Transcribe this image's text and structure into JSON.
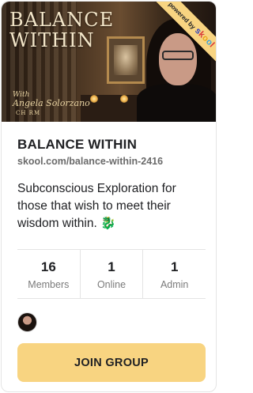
{
  "banner": {
    "title_line1": "BALANCE",
    "title_line2": "WITHIN",
    "with_text": "With",
    "host_name": "Angela Solorzano",
    "credentials": "CH RM",
    "ribbon_powered": "powered by",
    "ribbon_brand": [
      "s",
      "k",
      "o",
      "o",
      "l"
    ]
  },
  "group": {
    "name": "BALANCE WITHIN",
    "url": "skool.com/balance-within-2416",
    "description": "Subconscious Exploration for those that wish to meet their wisdom within.",
    "description_emoji": "🐉"
  },
  "stats": [
    {
      "value": "16",
      "label": "Members"
    },
    {
      "value": "1",
      "label": "Online"
    },
    {
      "value": "1",
      "label": "Admin"
    }
  ],
  "join_button": {
    "label": "JOIN GROUP"
  },
  "colors": {
    "accent": "#f8d481",
    "text": "#202124",
    "muted": "#7b7b7b"
  }
}
